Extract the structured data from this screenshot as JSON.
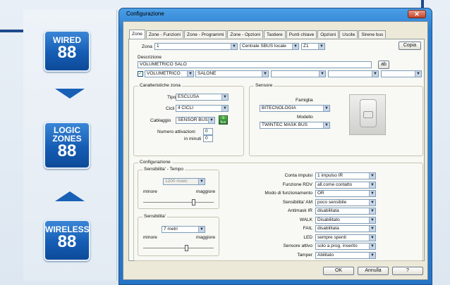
{
  "left": {
    "badges": [
      {
        "title": "WIRED",
        "number": "88"
      },
      {
        "title": "LOGIC ZONES",
        "number": "88"
      },
      {
        "title": "WIRELESS",
        "number": "88"
      }
    ]
  },
  "window": {
    "title": "Configurazione",
    "close": "✕",
    "tabs": [
      "Zone",
      "Zone - Funzioni",
      "Zone - Programmi",
      "Zone - Opzioni",
      "Tastiere",
      "Punti chiave",
      "Opzioni",
      "Uscite",
      "Sirene bus"
    ],
    "zona_label": "Zona",
    "zona_value": "1",
    "centrale_value": "Centrale SBUS locale",
    "z_value": "Z1",
    "copia": "Copia",
    "descrizione_label": "Descrizione",
    "descrizione_value": "VOLUMETRICO SALO",
    "desc_btn": "ab",
    "desc_row2": [
      "VOLUMETRICO",
      "SALONE",
      "",
      "",
      ""
    ],
    "car_label": "Caratteristiche zona",
    "tipo_label": "Tipo",
    "tipo_value": "ESCLUSA",
    "cicli_label": "Cicli",
    "cicli_value": "4 CICLI",
    "cablaggio_label": "Cablaggio",
    "cablaggio_value": "SENSOR BUS",
    "bus_btn": "S bus",
    "num_att_label": "Numero attivazioni",
    "num_att_value": "0",
    "minuti_label": "in minuti",
    "minuti_value": "0",
    "sensore_label": "Sensore",
    "famiglia_label": "Famiglia",
    "famiglia_value": "BITECNOLOGIA",
    "modello_label": "Modello",
    "modello_value": "TWINTEC MASK BUS",
    "config_label": "Configurazione",
    "sens_tempo_label": "Sensibilita' - Tempo",
    "sens_tempo_value": "1200",
    "sens_tempo_unit": "msec",
    "minore1": "minore",
    "maggiore1": "maggiore",
    "sens_label": "Sensibilita'",
    "sens_value": "7 metri",
    "minore2": "minore",
    "maggiore2": "maggiore",
    "options": [
      {
        "label": "Conta impulsi",
        "value": "1 impulso IR"
      },
      {
        "label": "Funzione RDV",
        "value": "all.come contatto"
      },
      {
        "label": "Modo di funzionamento",
        "value": "OR"
      },
      {
        "label": "Sensibilita' AM",
        "value": "poco sensibile"
      },
      {
        "label": "Antimask IR",
        "value": "disabilitata"
      },
      {
        "label": "WALK",
        "value": "Disabilitato"
      },
      {
        "label": "FAIL",
        "value": "disabilitata"
      },
      {
        "label": "LED",
        "value": "sempre spenti"
      },
      {
        "label": "Sensore attivo",
        "value": "solo a prog. inserito"
      },
      {
        "label": "Tamper",
        "value": "Abilitato"
      }
    ],
    "ok": "OK",
    "annulla": "Annulla",
    "help": "?"
  }
}
